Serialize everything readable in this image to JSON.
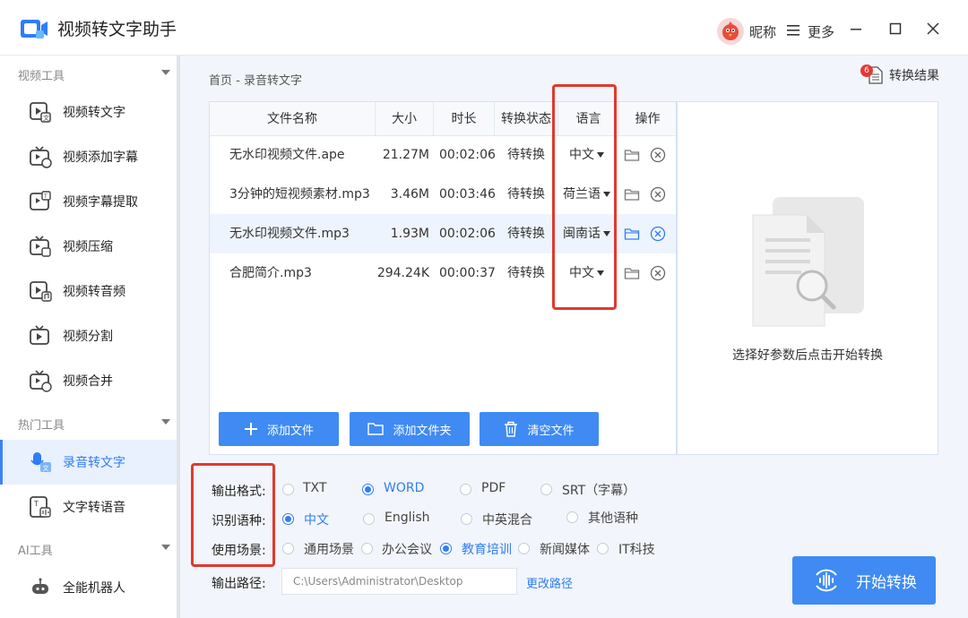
{
  "app": {
    "title": "视频转文字助手",
    "nickname": "昵称",
    "more": "更多"
  },
  "sidebar": {
    "sections": [
      {
        "label": "视频工具"
      },
      {
        "label": "热门工具"
      },
      {
        "label": "AI工具"
      }
    ],
    "items": [
      {
        "label": "视频转文字",
        "icon": "video-to-text-icon"
      },
      {
        "label": "视频添加字幕",
        "icon": "add-subtitle-icon"
      },
      {
        "label": "视频字幕提取",
        "icon": "subtitle-extract-icon"
      },
      {
        "label": "视频压缩",
        "icon": "compress-icon"
      },
      {
        "label": "视频转音频",
        "icon": "video-to-audio-icon"
      },
      {
        "label": "视频分割",
        "icon": "split-icon"
      },
      {
        "label": "视频合并",
        "icon": "merge-icon"
      },
      {
        "label": "录音转文字",
        "icon": "recording-to-text-icon",
        "active": true
      },
      {
        "label": "文字转语音",
        "icon": "text-to-speech-icon"
      },
      {
        "label": "全能机器人",
        "icon": "robot-icon"
      }
    ]
  },
  "breadcrumb": "首页 - 录音转文字",
  "results": {
    "label": "转换结果",
    "count": "6"
  },
  "table": {
    "headers": [
      "文件名称",
      "大小",
      "时长",
      "转换状态",
      "语言",
      "操作"
    ],
    "rows": [
      {
        "name": "无水印视频文件.ape",
        "size": "21.27M",
        "duration": "00:02:06",
        "status": "待转换",
        "lang": "中文"
      },
      {
        "name": "3分钟的短视频素材.mp3",
        "size": "3.46M",
        "duration": "00:03:46",
        "status": "待转换",
        "lang": "荷兰语"
      },
      {
        "name": "无水印视频文件.mp3",
        "size": "1.93M",
        "duration": "00:02:06",
        "status": "待转换",
        "lang": "闽南话"
      },
      {
        "name": "合肥简介.mp3",
        "size": "294.24K",
        "duration": "00:00:37",
        "status": "待转换",
        "lang": "中文"
      }
    ]
  },
  "buttons": {
    "add_file": "添加文件",
    "add_folder": "添加文件夹",
    "clear": "清空文件"
  },
  "preview": {
    "hint": "选择好参数后点击开始转换"
  },
  "options": {
    "format": {
      "label": "输出格式:",
      "choices": [
        "TXT",
        "WORD",
        "PDF",
        "SRT（字幕）"
      ],
      "selected": "WORD"
    },
    "language": {
      "label": "识别语种:",
      "choices": [
        "中文",
        "English",
        "中英混合",
        "其他语种"
      ],
      "selected": "中文"
    },
    "scene": {
      "label": "使用场景:",
      "choices": [
        "通用场景",
        "办公会议",
        "教育培训",
        "新闻媒体",
        "IT科技"
      ],
      "selected": "教育培训"
    },
    "path": {
      "label": "输出路径:",
      "value": "C:\\Users\\Administrator\\Desktop",
      "change": "更改路径"
    }
  },
  "start_button": "开始转换",
  "colors": {
    "accent": "#3f8bf3",
    "highlight": "#e03a2d"
  }
}
